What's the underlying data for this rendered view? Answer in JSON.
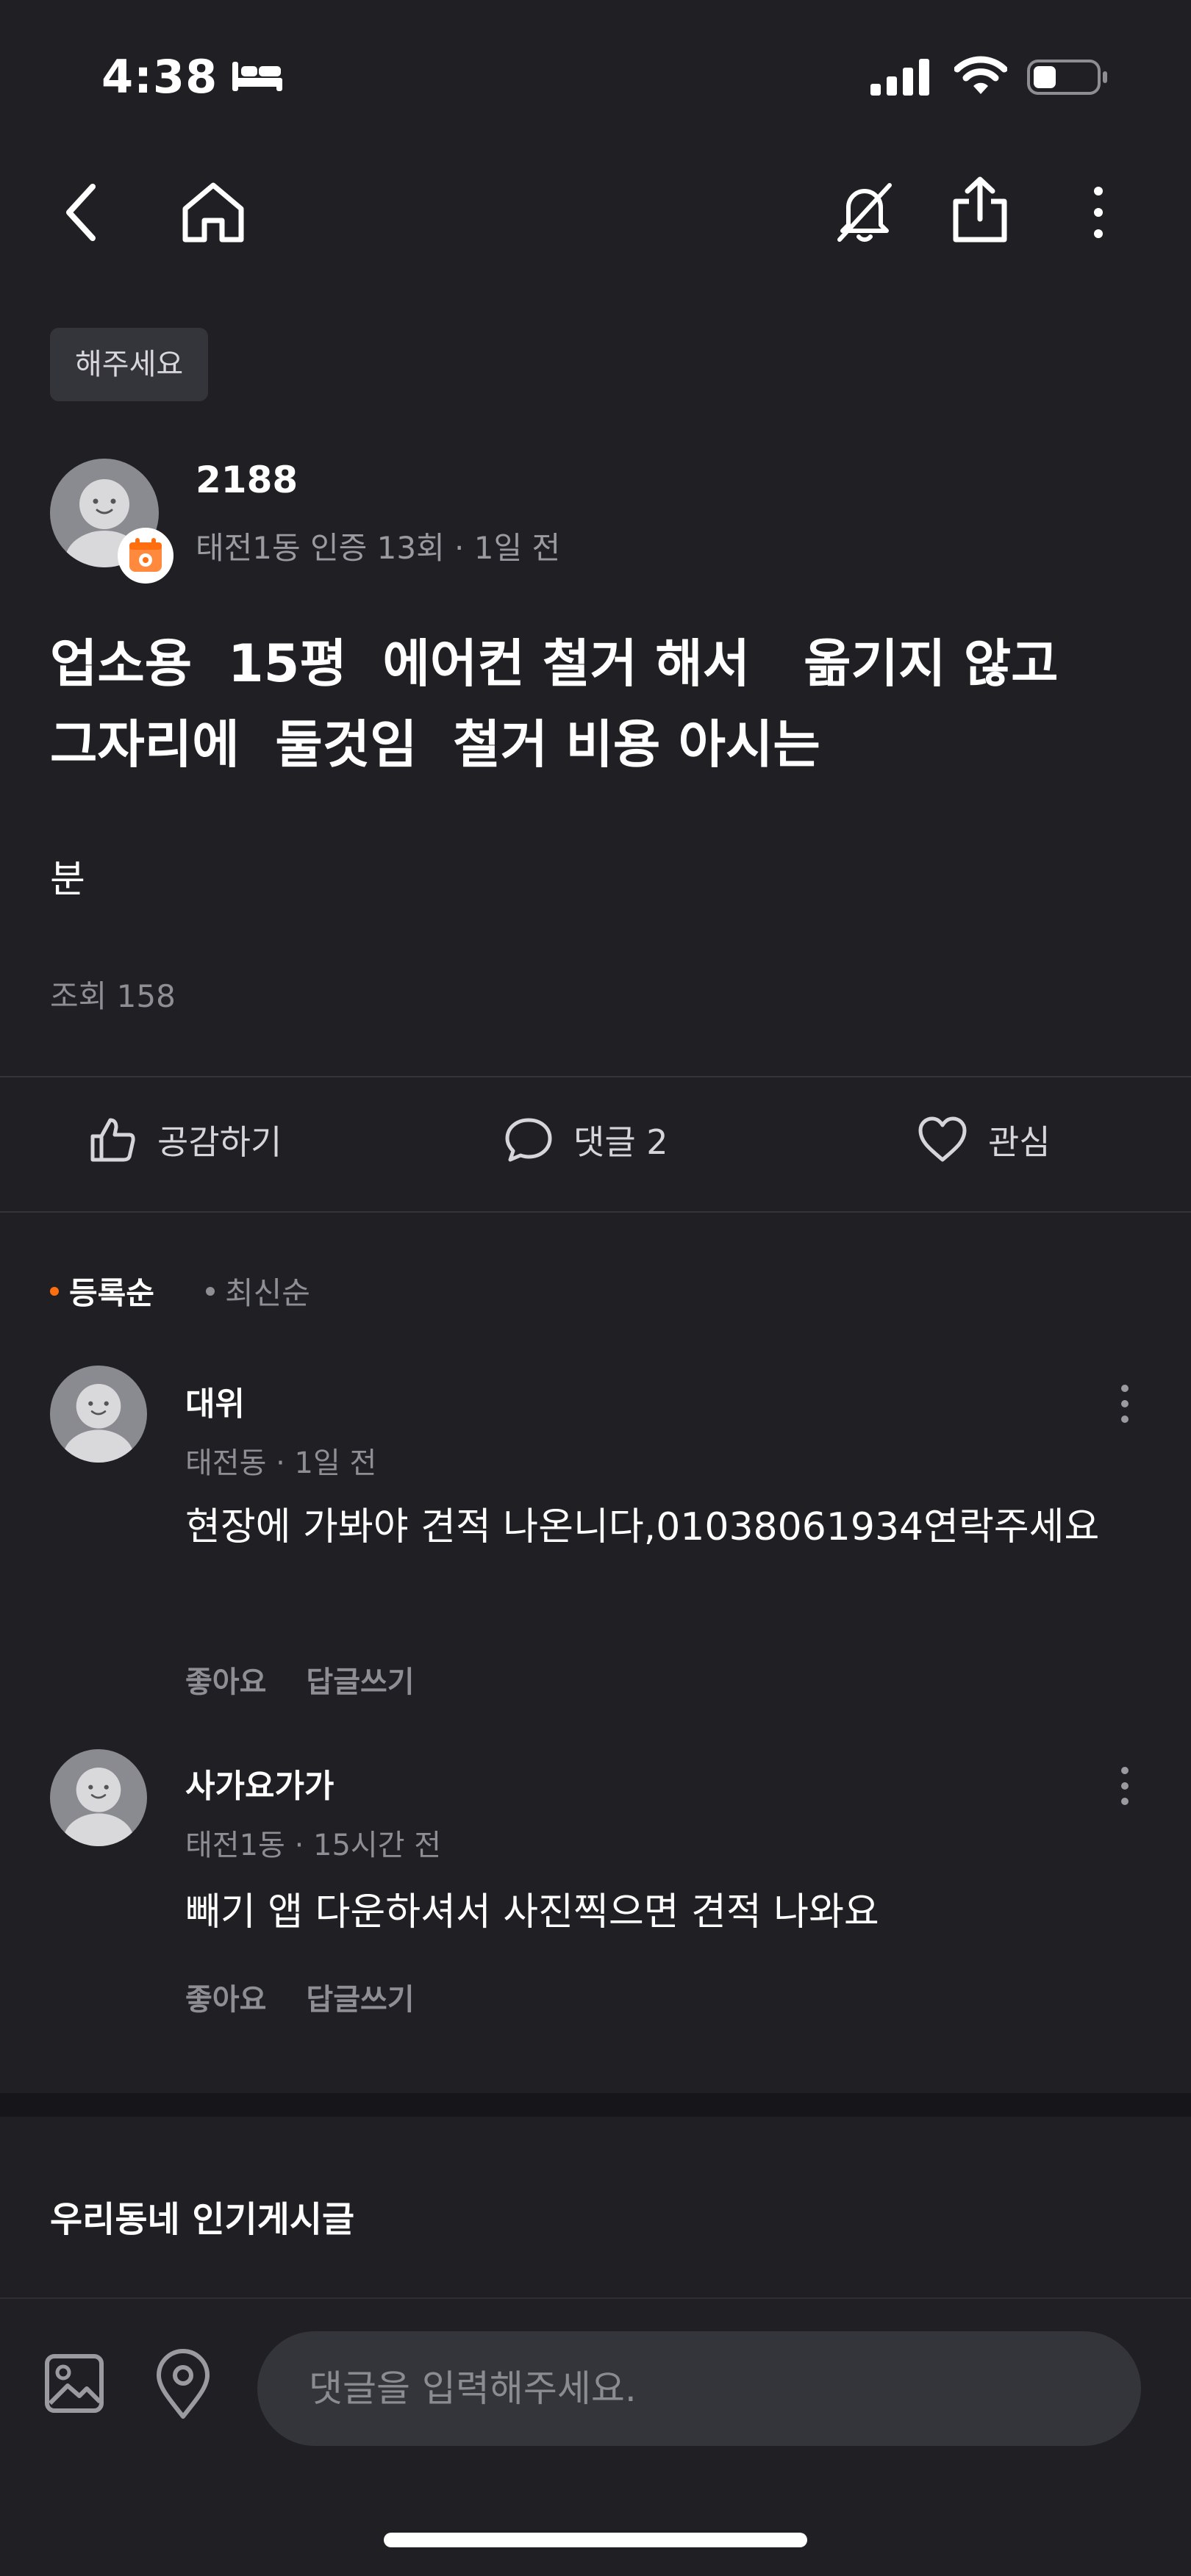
{
  "status_bar": {
    "time": "4:38"
  },
  "post": {
    "category": "해주세요",
    "author": "2188",
    "author_meta": "태전1동 인증 13회 · 1일 전",
    "title": "업소용  15평  에어컨 철거 해서   옮기지 않고\n그자리에  둘것임  철거 비용 아시는",
    "body": "분",
    "views": "조회 158"
  },
  "actions": {
    "like": "공감하기",
    "comment": "댓글 2",
    "interest": "관심"
  },
  "sort": {
    "registered": "등록순",
    "latest": "최신순"
  },
  "comments": [
    {
      "name": "대위",
      "meta": "태전동 · 1일 전",
      "text": "현장에 가봐야  견적 나온니다,01038061934연락주세요",
      "like_label": "좋아요",
      "reply_label": "답글쓰기"
    },
    {
      "name": "사가요가가",
      "meta": "태전1동 · 15시간 전",
      "text": "빼기 앱 다운하셔서 사진찍으면 견적 나와요",
      "like_label": "좋아요",
      "reply_label": "답글쓰기"
    }
  ],
  "popular": {
    "title": "우리동네 인기게시글"
  },
  "input": {
    "placeholder": "댓글을 입력해주세요."
  },
  "colors": {
    "background": "#202024",
    "accent": "#ff6f0f",
    "muted": "#8e8f95"
  }
}
